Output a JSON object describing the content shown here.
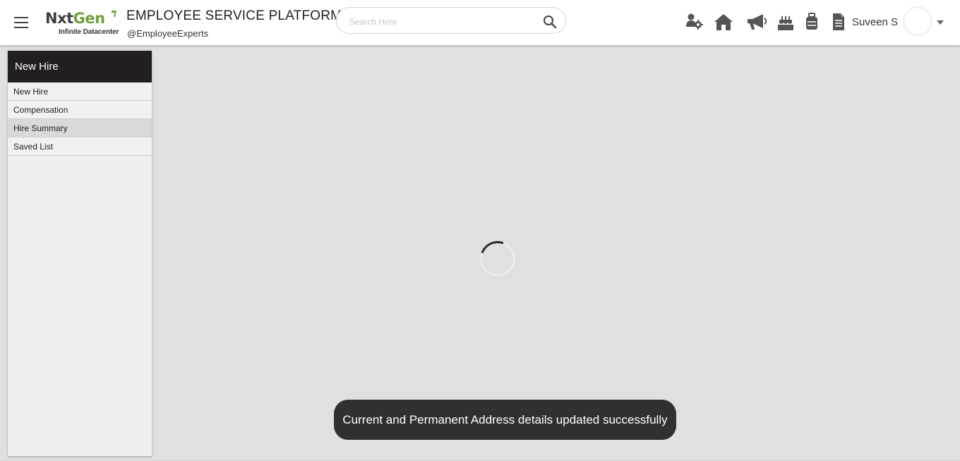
{
  "header": {
    "logo": {
      "brand_part1": "Nxt",
      "brand_part2": "Gen",
      "tagline": "Infinite Datacenter",
      "brand_color": "#6fa13c"
    },
    "title": "EMPLOYEE SERVICE PLATFORM",
    "subtitle": "@EmployeeExperts",
    "search": {
      "placeholder": "Search Here",
      "value": ""
    },
    "toolbar_icons": [
      "people-gear-icon",
      "home-icon",
      "megaphone-icon",
      "birthday-cake-icon",
      "luggage-icon",
      "document-icon"
    ],
    "user": {
      "name": "Suveen S"
    }
  },
  "sidebar": {
    "header": "New Hire",
    "items": [
      {
        "label": "New Hire",
        "active": false
      },
      {
        "label": "Compensation",
        "active": false
      },
      {
        "label": "Hire Summary",
        "active": true
      },
      {
        "label": "Saved List",
        "active": false
      }
    ]
  },
  "main": {
    "loading": true
  },
  "toast": {
    "message": "Current and Permanent Address details updated successfully"
  },
  "colors": {
    "sidebar_header_bg": "#231f20",
    "toast_bg": "#303030",
    "page_bg": "#e0e0e0",
    "icon_color": "#555555"
  }
}
